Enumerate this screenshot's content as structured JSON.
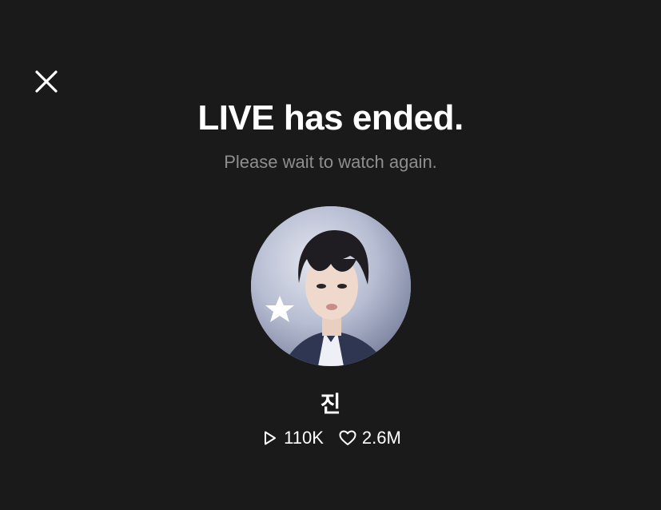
{
  "header": {
    "close_icon": "close-icon"
  },
  "main": {
    "title": "LIVE has ended.",
    "subtitle": "Please wait to watch again.",
    "profile": {
      "name": "진",
      "avatar_icon": "avatar",
      "badge_icon": "star-icon"
    },
    "stats": {
      "views": "110K",
      "likes": "2.6M",
      "views_icon": "play-icon",
      "likes_icon": "heart-icon"
    }
  },
  "colors": {
    "background": "#1b1a1a",
    "title": "#ffffff",
    "subtitle": "#8e8e8e"
  }
}
